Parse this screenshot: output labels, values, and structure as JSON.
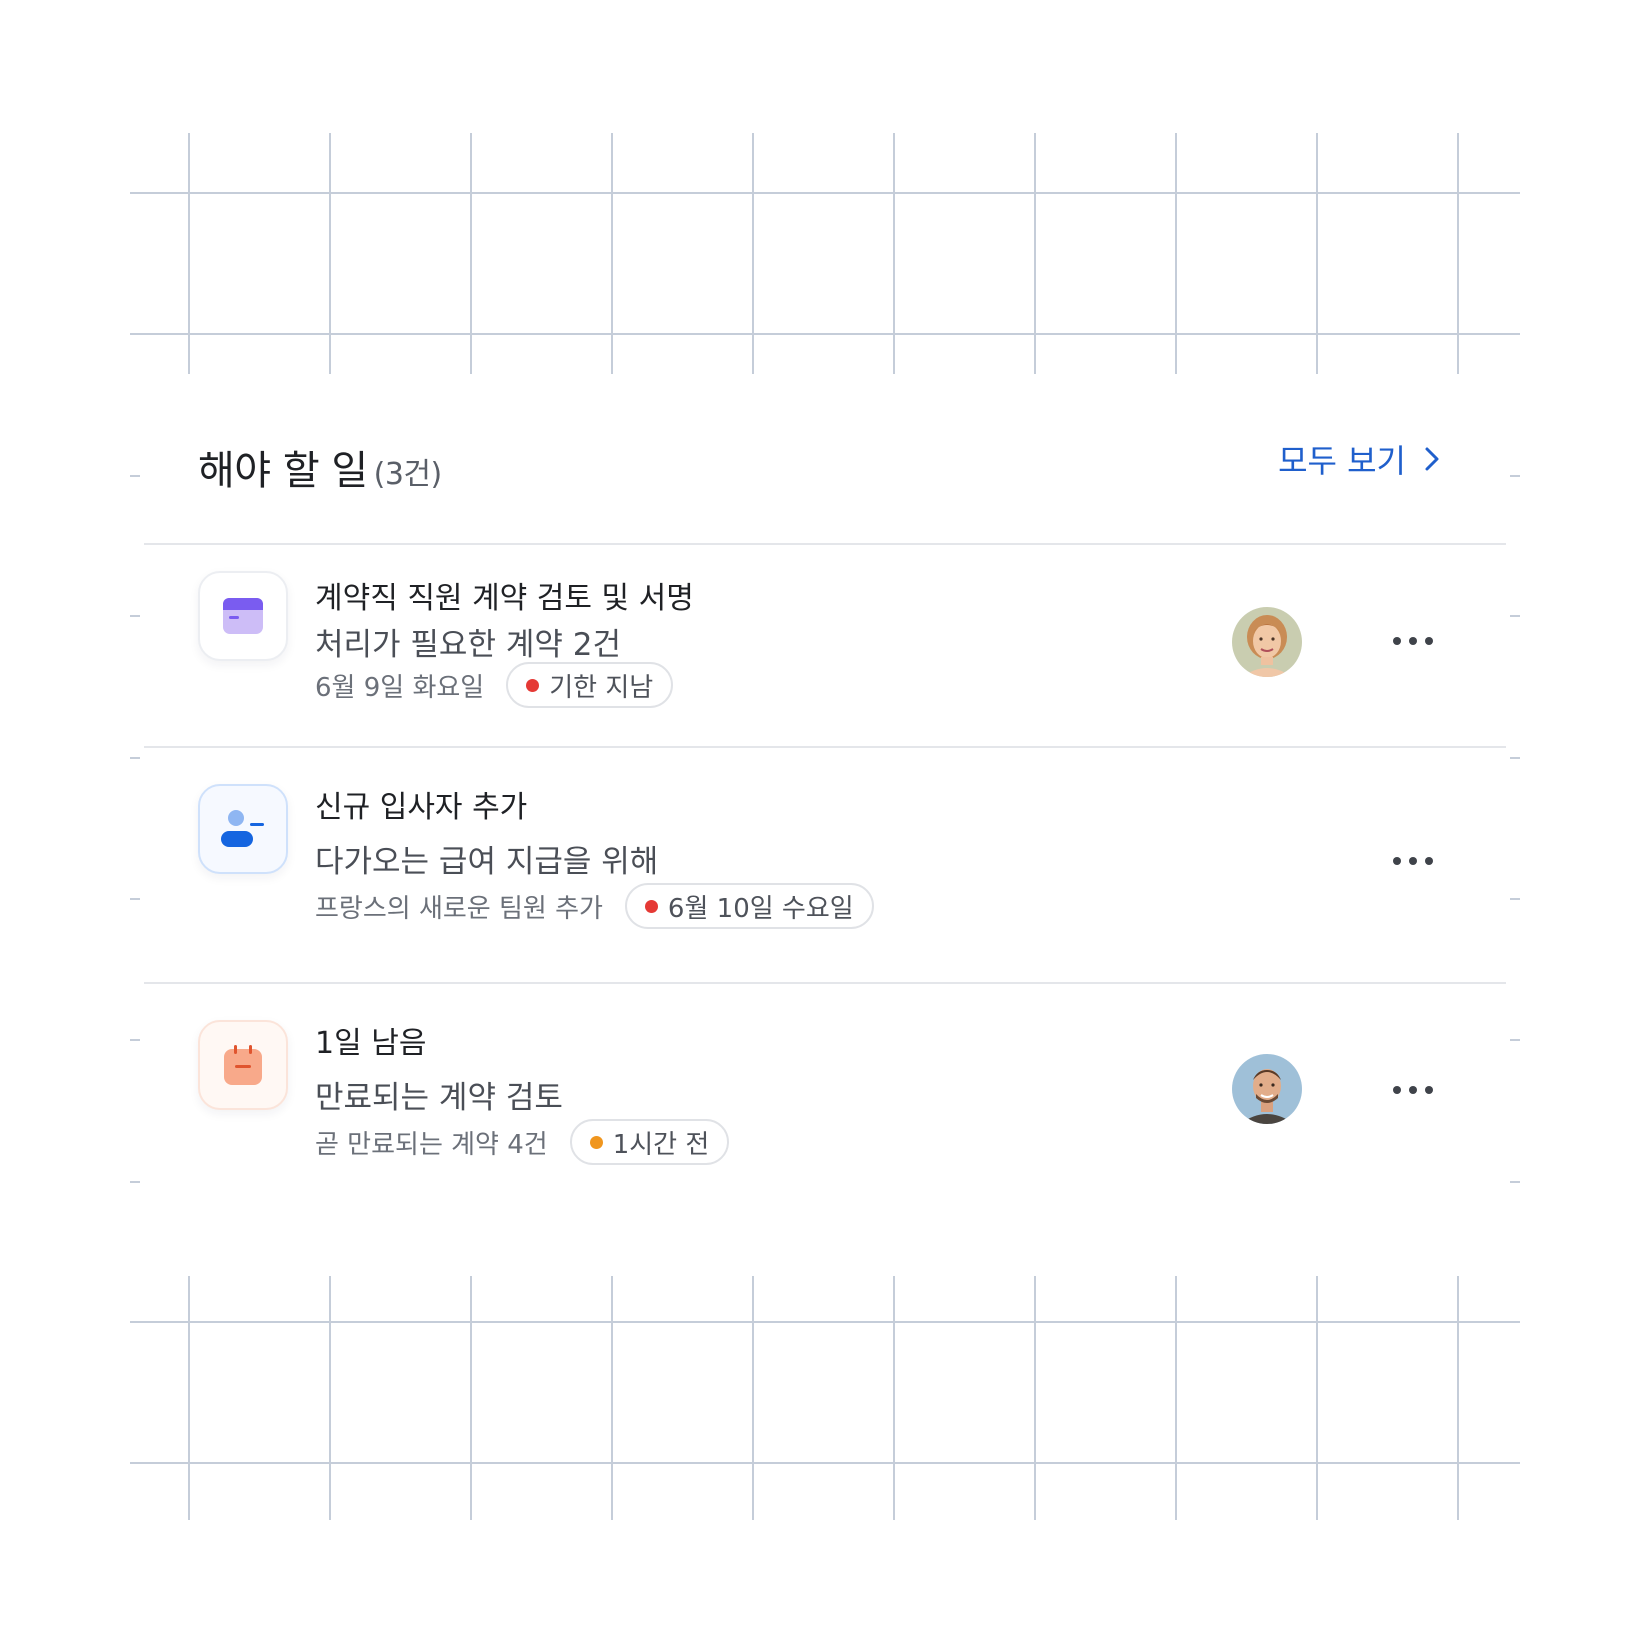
{
  "header": {
    "title": "해야 할 일",
    "count": "(3건)",
    "view_all": "모두 보기"
  },
  "tasks": [
    {
      "title": "계약직 직원 계약 검토 및 서명",
      "subtitle": "처리가 필요한 계약 2건",
      "meta": "6월 9일 화요일",
      "pill": "기한 지남",
      "pill_dot_color": "#e53935",
      "icon": "wallet-icon",
      "has_avatar": true
    },
    {
      "title": "신규 입사자 추가",
      "subtitle": "다가오는 급여 지급을 위해",
      "meta": "프랑스의 새로운 팀원 추가",
      "pill": "6월 10일 수요일",
      "pill_dot_color": "#e53935",
      "icon": "add-user-icon",
      "has_avatar": false
    },
    {
      "title": "1일 남음",
      "subtitle": "만료되는 계약 검토",
      "meta": "곧 만료되는 계약 4건",
      "pill": "1시간 전",
      "pill_dot_color": "#f0961e",
      "icon": "calendar-icon",
      "has_avatar": true
    }
  ],
  "colors": {
    "accent": "#1f5fcc",
    "grid": "#c5cdd9"
  }
}
